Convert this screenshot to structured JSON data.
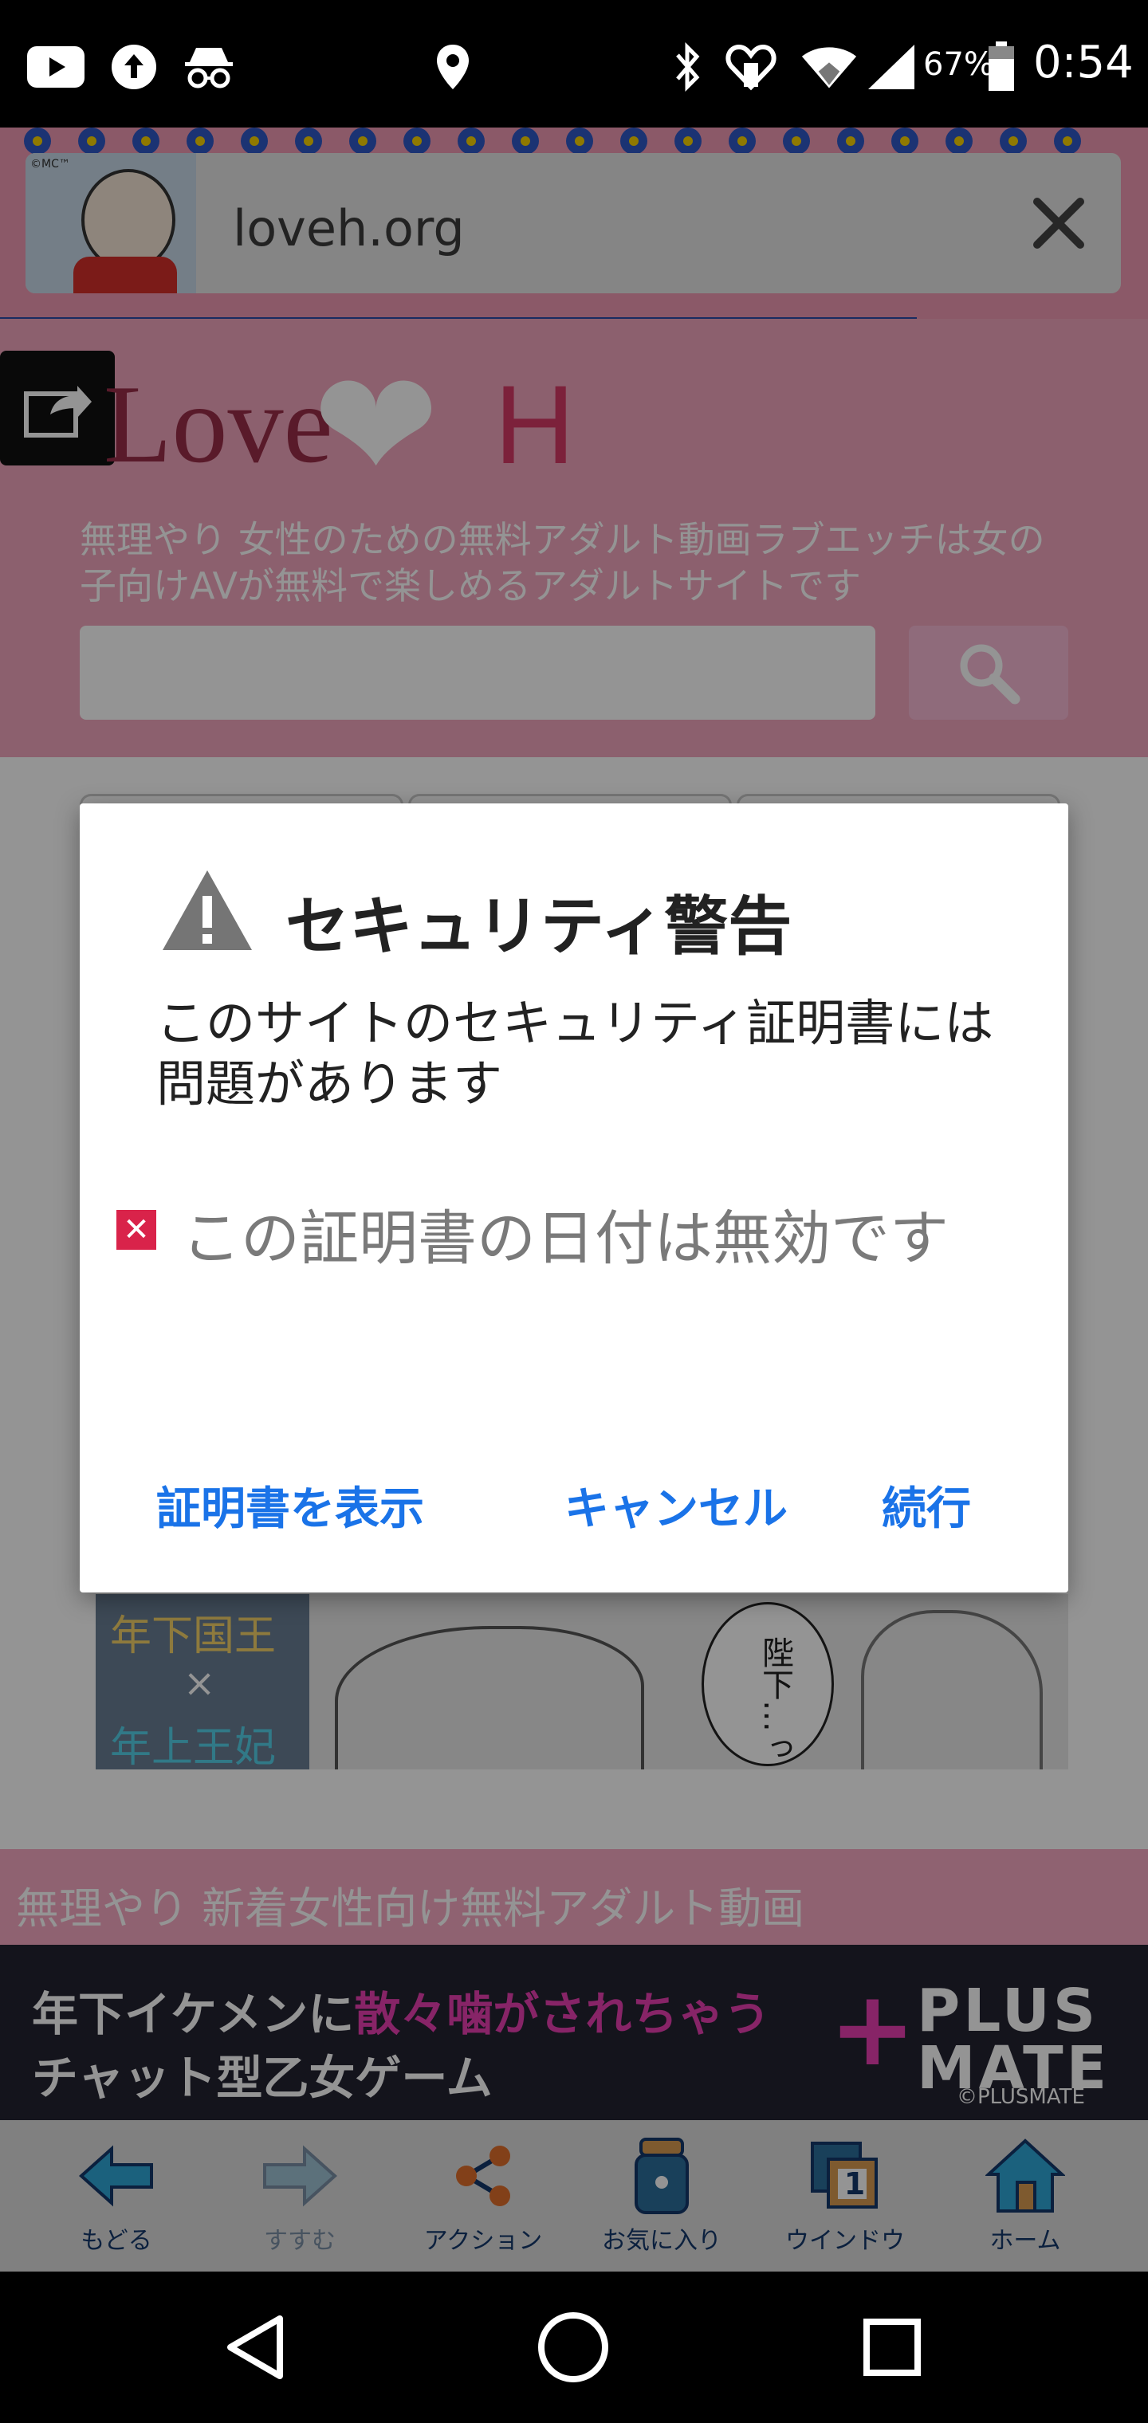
{
  "status_bar": {
    "time": "0:54",
    "battery_percent": "67%",
    "icons": [
      "youtube-icon",
      "upload-icon",
      "incognito-icon",
      "location-icon",
      "bluetooth-icon",
      "heart-signal-icon",
      "wifi-icon",
      "cellular-icon",
      "battery-icon"
    ]
  },
  "browser": {
    "url": "loveh.org",
    "thumb_label": "©MC™"
  },
  "site": {
    "logo_love": "Love",
    "logo_heart": "❤",
    "logo_h": "H",
    "tagline": "無理やり 女性のための無料アダルト動画ラブエッチは女の子向けAVが無料で楽しめるアダルトサイトです",
    "search_placeholder": "",
    "manga_line1": "年下国王",
    "manga_line2": "×",
    "manga_line3": "年上王妃",
    "manga_bubble": "陛下…っ",
    "section_band": "無理やり 新着女性向け無料アダルト動画",
    "ad_line1_prefix": "年下イケメンに",
    "ad_line1_highlight": "散々噛がされちゃう",
    "ad_line2": "チャット型乙女ゲーム",
    "ad_brand_line1": "PLUS",
    "ad_brand_line2": "MATE",
    "ad_copyright": "©PLUSMATE"
  },
  "toolbar": {
    "back": "もどる",
    "forward": "すすむ",
    "action": "アクション",
    "favorites": "お気に入り",
    "window": "ウインドウ",
    "window_count": "1",
    "home": "ホーム"
  },
  "dialog": {
    "title": "セキュリティ警告",
    "message": "このサイトのセキュリティ証明書には問題があります",
    "error": "この証明書の日付は無効です",
    "btn_view": "証明書を表示",
    "btn_cancel": "キャンセル",
    "btn_continue": "続行"
  },
  "colors": {
    "accent": "#1a73e8",
    "site_pink": "#f2a6bd",
    "error_red": "#d9234a"
  }
}
